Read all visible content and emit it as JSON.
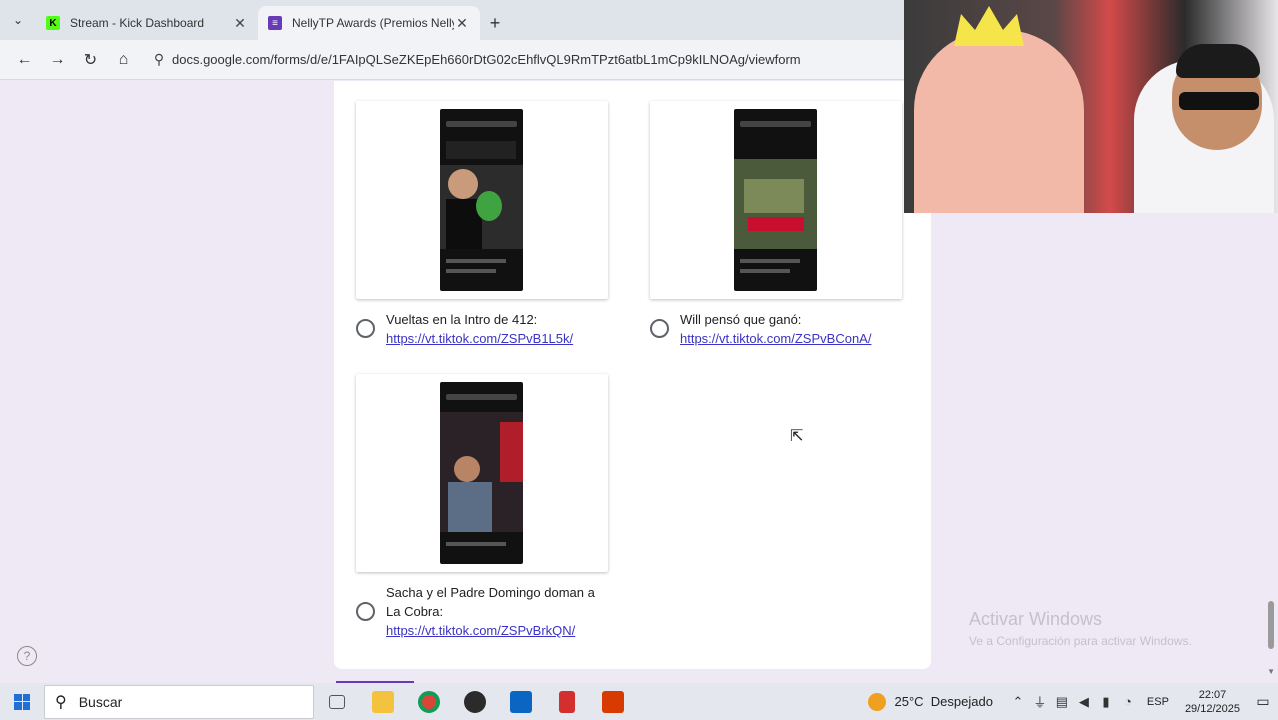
{
  "browser": {
    "tabs": [
      {
        "title": "Stream - Kick Dashboard",
        "favicon": "kick-icon",
        "color": "#53fc18",
        "active": false
      },
      {
        "title": "NellyTP Awards (Premios Nelly",
        "favicon": "forms-icon",
        "color": "#673ab7",
        "active": true
      }
    ],
    "url": "docs.google.com/forms/d/e/1FAIpQLSeZKEpEh660rDtG02cEhflvQL9RmTPzt6atbL1mCp9kILNOAg/viewform"
  },
  "form": {
    "options": [
      {
        "label": "Vueltas en la Intro de 412:",
        "link": "https://vt.tiktok.com/ZSPvB1L5k/"
      },
      {
        "label": "Will pensó que ganó:",
        "link": "https://vt.tiktok.com/ZSPvBConA/"
      },
      {
        "label_line1": "Sacha y el Padre Domingo doman a",
        "label_line2": "La Cobra:",
        "link": "https://vt.tiktok.com/ZSPvBrkQN/"
      }
    ],
    "accent": "#673ab7"
  },
  "watermark": {
    "title": "Activar Windows",
    "subtitle": "Ve a Configuración para activar Windows."
  },
  "help_icon": "?",
  "taskbar": {
    "search_placeholder": "Buscar",
    "weather_temp": "25°C",
    "weather_text": "Despejado",
    "language": "ESP",
    "time": "22:07",
    "date": "29/12/2025",
    "apps": [
      "task-view-icon",
      "file-explorer-icon",
      "chrome-icon",
      "obs-icon",
      "store-icon",
      "pdf-icon",
      "office-icon"
    ]
  }
}
